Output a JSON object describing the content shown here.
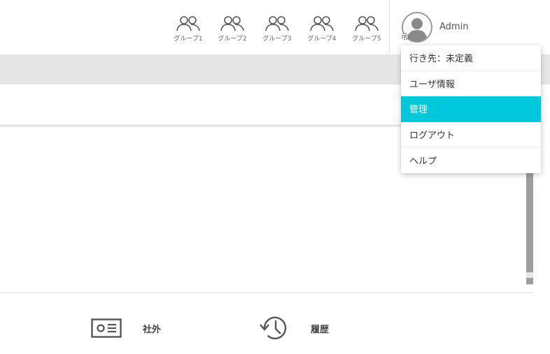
{
  "header": {
    "groups": [
      {
        "label": "グループ1"
      },
      {
        "label": "グループ2"
      },
      {
        "label": "グループ3"
      },
      {
        "label": "グループ4"
      },
      {
        "label": "グループ5"
      }
    ],
    "user_name": "Admin"
  },
  "menu": {
    "items": [
      {
        "label": "行き先：未定義"
      },
      {
        "label": "ユーザ情報"
      },
      {
        "label": "管理",
        "active": true
      },
      {
        "label": "ログアウト"
      },
      {
        "label": "ヘルプ"
      }
    ],
    "active_color": "#00c8d8"
  },
  "footer": {
    "external_label": "社外",
    "history_label": "履歴"
  }
}
